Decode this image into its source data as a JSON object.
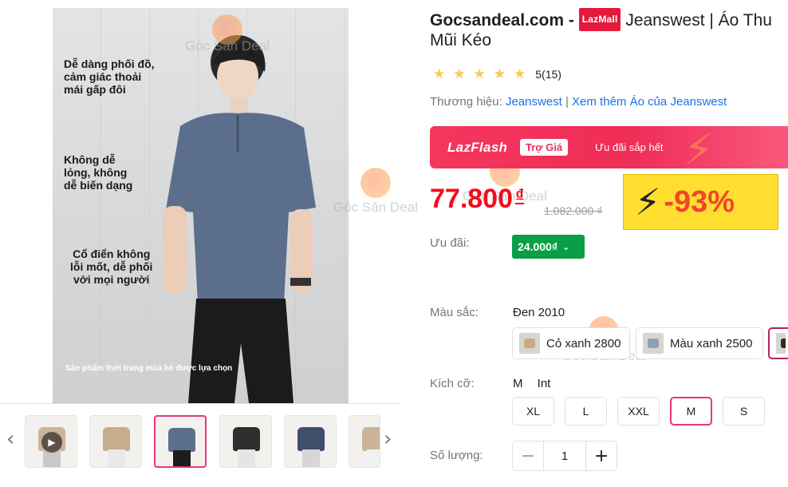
{
  "gallery": {
    "main_image": {
      "caption_1": "Dễ dàng phối đồ,\ncảm giác thoải\nmái gấp đôi",
      "caption_2": "Không dễ\nlỏng, không\ndễ biến dạng",
      "caption_3": "Cổ điển không\nlỗi mốt, dễ phối\nvới mọi người",
      "caption_bottom": "Sản phẩm thời trang mùa hè được lựa chọn"
    },
    "watermark": "Góc Săn Deal",
    "prev_arrow": "‹",
    "next_arrow": "›",
    "thumbnails": [
      {
        "shirt_color": "#c9b49a",
        "legs_color": "#c8c8c8",
        "is_video": true
      },
      {
        "shirt_color": "#c6ad8c",
        "legs_color": "#e9e9e9",
        "is_video": false
      },
      {
        "shirt_color": "#5b6f8c",
        "legs_color": "#1d1d1d",
        "is_video": false
      },
      {
        "shirt_color": "#2e2e2e",
        "legs_color": "#e5e5e5",
        "is_video": false
      },
      {
        "shirt_color": "#3f4f6b",
        "legs_color": "#d6d6d6",
        "is_video": false
      },
      {
        "shirt_color": "#c9b49a",
        "legs_color": "#f1f1f1",
        "is_video": false
      }
    ],
    "active_thumbnail": 2
  },
  "product": {
    "title_prefix": "Gocsandeal.com - ",
    "badge": "LazMall",
    "title_main": " Jeanswest | Áo Thu",
    "title_line2": "Mũi Kéo",
    "rating_stars": 5,
    "rating_text": "5(15)",
    "brand_label": "Thương hiệu: ",
    "brand_name": "Jeanswest",
    "brand_sep": " | ",
    "brand_more": "Xem thêm Áo của Jeanswest"
  },
  "flash": {
    "logo": "LazFlash",
    "tag": "Trợ Giá",
    "ending": "Ưu đãi sắp hết"
  },
  "pricing": {
    "price": "77.800",
    "currency": "₫",
    "old_price": "1.082.000 ₫",
    "discount": "-93%"
  },
  "voucher": {
    "label": "Ưu đãi:",
    "value": "24.000₫",
    "chevron": "⌄"
  },
  "colors": {
    "label": "Màu sắc:",
    "current": "Đen 2010",
    "options": [
      {
        "name": "Cỏ xanh 2800",
        "swatch": "#c7ab86"
      },
      {
        "name": "Màu xanh 2500",
        "swatch": "#8ea0b8"
      },
      {
        "name": "",
        "swatch": "#2a2a2a"
      }
    ]
  },
  "sizes": {
    "label": "Kích cỡ:",
    "current": "M Int",
    "options": [
      "XL",
      "L",
      "XXL",
      "M",
      "S"
    ],
    "active": "M"
  },
  "quantity": {
    "label": "Số lượng:",
    "value": "1",
    "minus": "−",
    "plus": "+"
  },
  "colors_theme": {
    "accent_pink": "#e8367c",
    "price_red": "#f20d1b",
    "voucher_green": "#0a9e47",
    "link_blue": "#1a73e8",
    "discount_yellow": "#ffde2f"
  }
}
